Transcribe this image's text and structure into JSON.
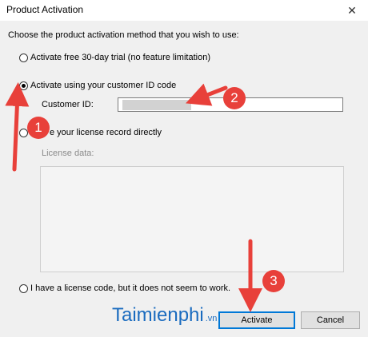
{
  "window": {
    "title": "Product Activation",
    "close_glyph": "✕"
  },
  "dialog": {
    "instruction": "Choose the product activation method that you wish to use:",
    "options": [
      {
        "label": "Activate free 30-day trial (no feature limitation)",
        "checked": false
      },
      {
        "label": "Activate using your customer ID code",
        "checked": true
      },
      {
        "label": "e your license record directly",
        "checked": false
      },
      {
        "label": "I have a license code, but it does not seem to work.",
        "checked": false
      }
    ],
    "customer_id_label": "Customer ID:",
    "customer_id_value": "",
    "license_data_label": "License data:"
  },
  "buttons": {
    "activate": "Activate",
    "cancel": "Cancel"
  },
  "annotations": {
    "step1": "1",
    "step2": "2",
    "step3": "3",
    "arrow_color": "#e8403a"
  },
  "watermark": {
    "brand": "Taimienphi",
    "suffix": ".vn"
  }
}
